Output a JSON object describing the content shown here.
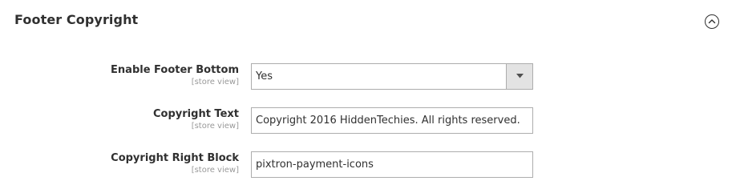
{
  "section": {
    "title": "Footer Copyright",
    "toggle_icon": "chevron-up-circle-icon"
  },
  "fields": [
    {
      "label": "Enable Footer Bottom",
      "scope": "[store view]",
      "type": "select",
      "value": "Yes"
    },
    {
      "label": "Copyright Text",
      "scope": "[store view]",
      "type": "text",
      "value": "Copyright 2016 HiddenTechies. All rights reserved."
    },
    {
      "label": "Copyright Right Block",
      "scope": "[store view]",
      "type": "text",
      "value": "pixtron-payment-icons"
    }
  ],
  "colors": {
    "text": "#303030",
    "scope_text": "#999999",
    "border": "#adadad",
    "select_button": "#e3e3e3"
  }
}
